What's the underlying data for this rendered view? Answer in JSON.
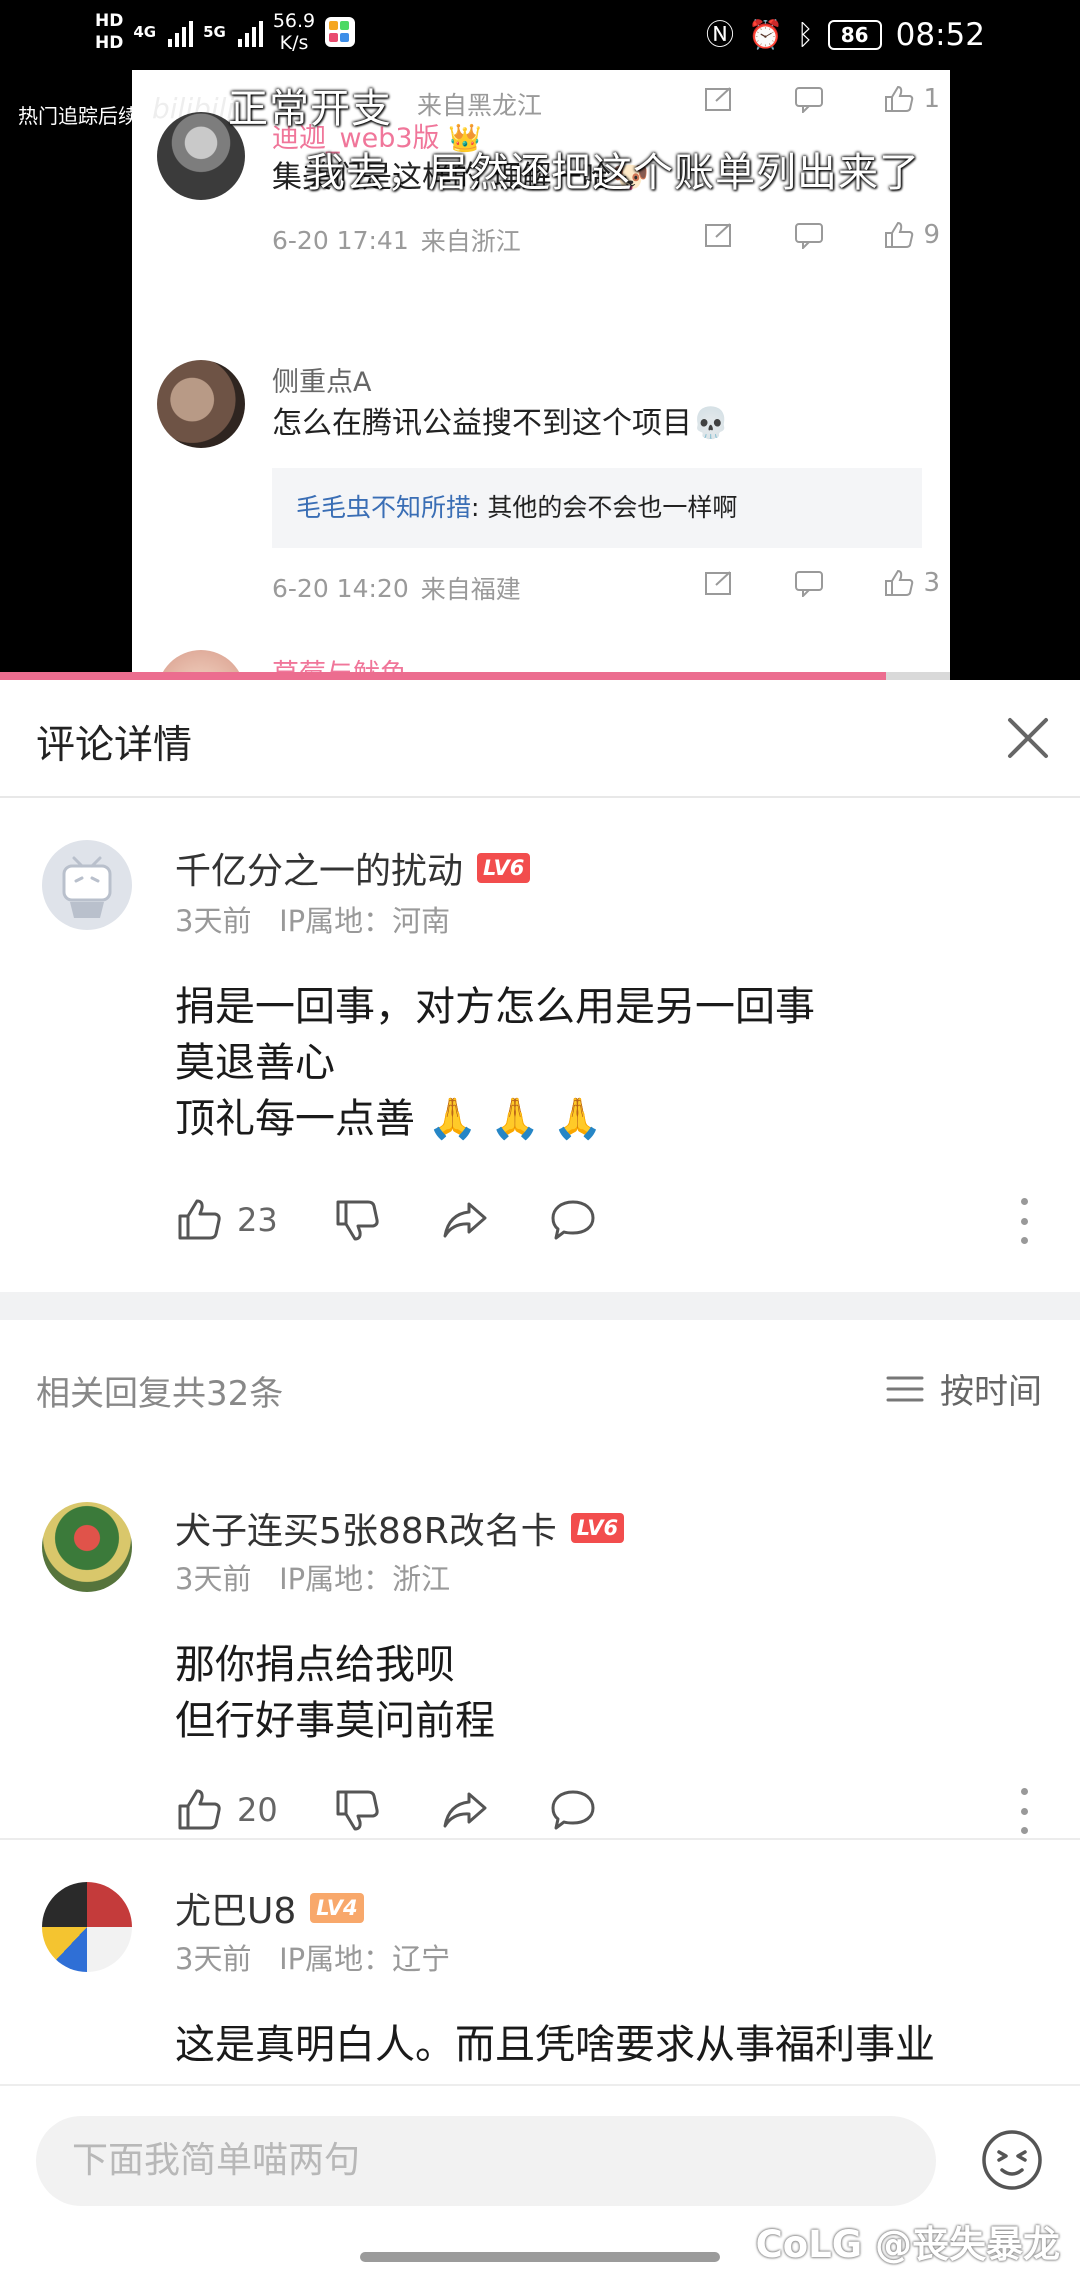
{
  "status_bar": {
    "hd1": "HD",
    "hd2": "HD",
    "net1": "4G",
    "net2": "5G",
    "speed_value": "56.9",
    "speed_unit": "K/s",
    "battery": "86",
    "time": "08:52"
  },
  "video": {
    "side_label": "热门追踪后续",
    "watermark": "bilibili",
    "subtitle_top": "正常开支",
    "subtitle_main": "我去，居然还把这个账单列出来了",
    "progress": 0.82,
    "in_frame": {
      "top_meta_location": "来自黑龙江",
      "top_like_count": "1",
      "c1_name": "迪迦_web3版",
      "c1_text": "集美们是这样的 理解一哈",
      "c1_date": "6-20 17:41",
      "c1_location": "来自浙江",
      "c1_likes": "9",
      "c2_name": "侧重点A",
      "c2_text": "怎么在腾讯公益搜不到这个项目",
      "c2_reply_name": "毛毛虫不知所措",
      "c2_reply_text": ": 其他的会不会也一样啊",
      "c2_date": "6-20 14:20",
      "c2_location": "来自福建",
      "c2_likes": "3",
      "c3_name": "草莓与鱿鱼"
    }
  },
  "panel": {
    "title": "评论详情",
    "main_comment": {
      "username": "千亿分之一的扰动",
      "level": "LV6",
      "time": "3天前",
      "ip": "IP属地：河南",
      "lines": [
        "捐是一回事，对方怎么用是另一回事",
        "莫退善心",
        "顶礼每一点善 🙏 🙏 🙏"
      ],
      "likes": "23"
    },
    "replies_count": "相关回复共32条",
    "sort_label": "按时间",
    "replies": [
      {
        "username": "犬子连买5张88R改名卡",
        "level": "LV6",
        "time": "3天前",
        "ip": "IP属地：浙江",
        "lines": [
          "那你捐点给我呗",
          "但行好事莫问前程"
        ],
        "likes": "20"
      },
      {
        "username": "尤巴U8",
        "level": "LV4",
        "time": "3天前",
        "ip": "IP属地：辽宁",
        "lines": [
          "这是真明白人。而且凭啥要求从事福利事业"
        ]
      }
    ],
    "input_placeholder": "下面我简单喵两句",
    "credit": "CoLG @丧失暴龙"
  },
  "colors": {
    "accent_pink": "#ec6d8f",
    "lv6": "#f24d4d",
    "lv4": "#f8a86b",
    "link_blue": "#3a6eb5",
    "vip_name": "#f0769a"
  }
}
